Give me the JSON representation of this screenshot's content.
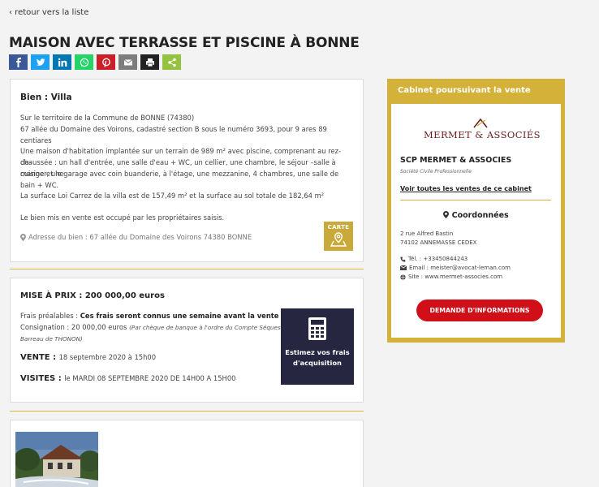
{
  "nav": {
    "back": "‹ retour vers la liste"
  },
  "page": {
    "title": "MAISON AVEC TERRASSE ET PISCINE À BONNE"
  },
  "share": [
    {
      "name": "facebook",
      "color": "#3b5998"
    },
    {
      "name": "twitter",
      "color": "#1da1f2"
    },
    {
      "name": "linkedin",
      "color": "#0077b5"
    },
    {
      "name": "whatsapp",
      "color": "#25d366"
    },
    {
      "name": "pinterest",
      "color": "#cb2027"
    },
    {
      "name": "email",
      "color": "#7d7d7d"
    },
    {
      "name": "print",
      "color": "#222222"
    },
    {
      "name": "share",
      "color": "#95c341"
    }
  ],
  "property": {
    "heading": "Bien : Villa",
    "line1": "Sur le territoire de la Commune de BONNE (74380)",
    "line2": "67 allée du Domaine des Voirons, cadastré section B sous le numéro 3693, pour 9 ares 89 centiares",
    "desc1": "Une maison d'habitation implantée sur un terrain de 989 m² avec piscine, comprenant au rez-de-",
    "desc2": "chaussée : un hall d'entrée, une salle d'eau + WC, un cellier, une chambre, le séjour –salle à manger, une",
    "desc3": "cuisine et le garage avec coin buanderie, à l'étage, une mezzanine, 4 chambres, une salle de bain + WC.",
    "surface": "La surface Loi Carrez de la villa est de 157,49 m² et la surface au sol totale de 182,64 m²",
    "occupancy": "Le bien mis en vente est occupé par les propriétaires saisis.",
    "address": "Adresse du bien : 67 allée du Domaine des Voirons 74380 BONNE",
    "map_label": "CARTE"
  },
  "sale": {
    "price_label": "MISE À PRIX : 200 000,00 euros",
    "fees_label": "Frais préalables : ",
    "fees_value": "Ces frais seront connus une semaine avant la vente",
    "deposit_label": "Consignation : 20 000,00 euros ",
    "deposit_note1": "(Par chèque de banque à l'ordre du Compte Séquestre du",
    "deposit_note2": "Barreau de THONON)",
    "sale_label": "VENTE : ",
    "sale_date": "18 septembre 2020 à 15h00",
    "visits_label": "VISITES : ",
    "visits_date": "le MARDI 08 SEPTEMBRE 2020 DE 14H00 A 15H00",
    "estimate_line1": "Estimez vos frais",
    "estimate_line2": "d'acquisition"
  },
  "sidebar": {
    "heading": "Cabinet poursuivant la vente",
    "logo_text": "MERMET & ASSOCIÉS",
    "firm": "SCP MERMET & ASSOCIES",
    "firm_sub": "Société Civile Professionnelle",
    "all_sales": "Voir toutes les ventes de ce cabinet",
    "coords_heading": "Coordonnées",
    "street": "2 rue Alfred Bastin",
    "city": "74102 ANNEMASSE CEDEX",
    "phone": "Tél. : +33450844243",
    "email": "Email : meister@avocat-leman.com",
    "site": "Site : www.mermet-associes.com",
    "cta": "DEMANDE D'INFORMATIONS",
    "accent": "#d4b23a",
    "cta_color": "#d10f18"
  }
}
